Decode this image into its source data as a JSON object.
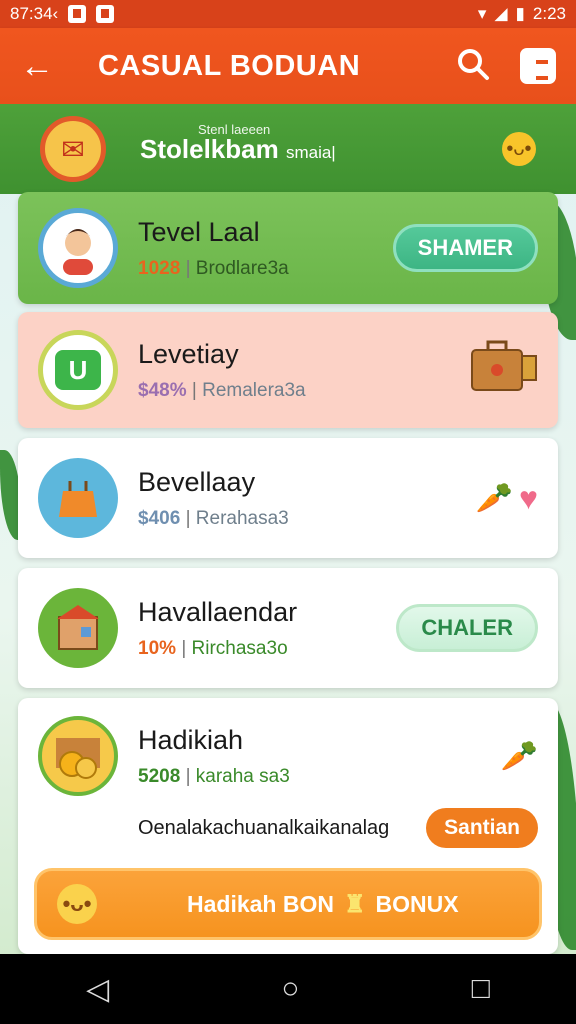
{
  "status_bar": {
    "time_left": "87:34‹",
    "time_right": "2:23"
  },
  "app_bar": {
    "title": "CASUAL BODUAN",
    "back_icon": "arrow-left-icon",
    "search_icon": "search-icon",
    "menu_icon": "menu-icon"
  },
  "banner": {
    "title": "Stolelkbam",
    "title_suffix": "smaia|",
    "subtitle": "Stenl laeeen"
  },
  "cards": [
    {
      "name": "Tevel Laal",
      "pct": "1028",
      "detail": "Brodlare3a",
      "pct_color": "#e8641e",
      "button": "SHAMER"
    },
    {
      "name": "Levetiay",
      "pct": "$48%",
      "detail": "Remalera3a",
      "pct_color": "#9a6fb0"
    },
    {
      "name": "Bevellaay",
      "pct": "$406",
      "detail": "Rerahasa3",
      "pct_color": "#6f8fb0"
    },
    {
      "name": "Havallaendar",
      "pct": "10%",
      "detail": "Rirchasa3o",
      "pct_color": "#e8641e",
      "button": "CHALER"
    },
    {
      "name": "Hadikiah",
      "pct": "5208",
      "detail": "karaha sa3",
      "pct_color": "#3a8a2a",
      "description": "Oenalakachuanalkaikanalag",
      "button": "Santian"
    }
  ],
  "bonus": {
    "label_1": "Hadikah BON",
    "label_2": "BONUX"
  }
}
